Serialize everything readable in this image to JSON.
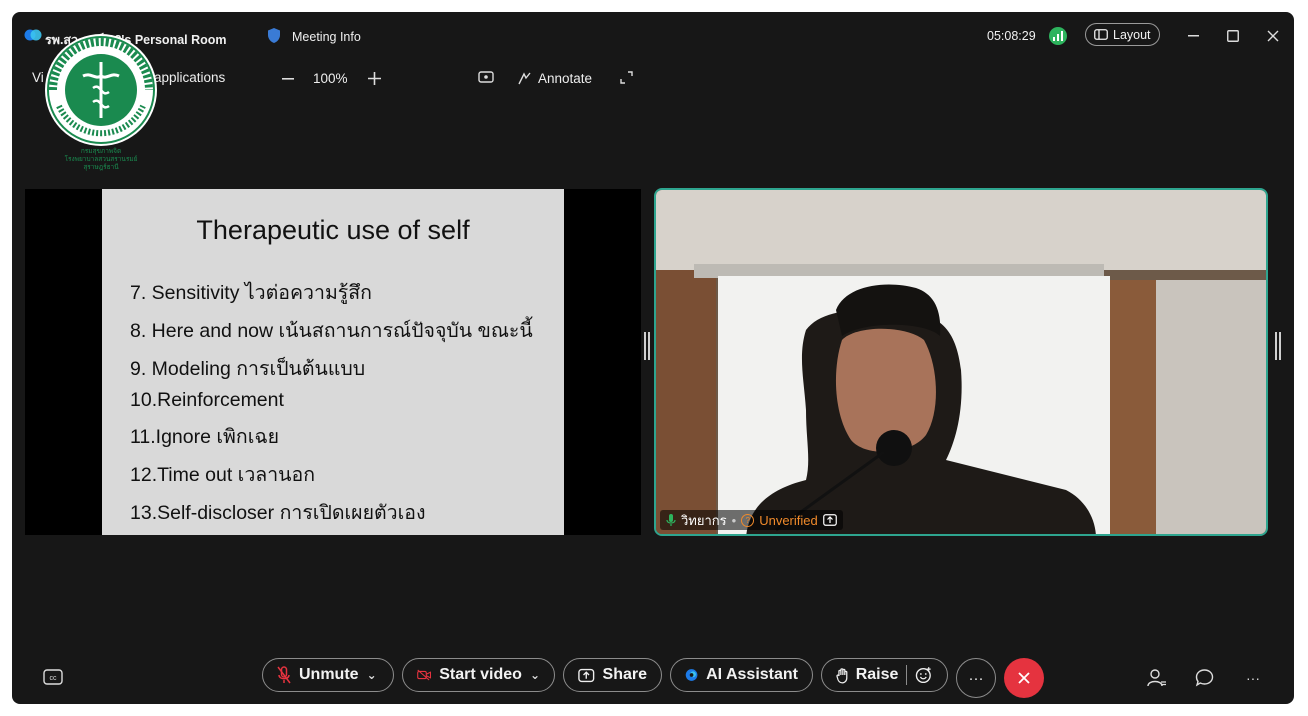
{
  "titlebar": {
    "room_title": "รพ.สว...มย์ 02's Personal Room",
    "meeting_info": "Meeting Info",
    "timer": "05:08:29",
    "layout_label": "Layout"
  },
  "share_toolbar": {
    "view_label": "Vi",
    "applications_label": "applications",
    "zoom_level": "100%",
    "annotate_label": "Annotate"
  },
  "logo": {
    "ring_text": "กระทรวงสาธารณสุข MINISTRY OF PUBLIC HEALTH",
    "caption_lines": [
      "กรมสุขภาพจิต",
      "โรงพยาบาลสวนสรานรมย์",
      "สุราษฎร์ธานี"
    ]
  },
  "slide": {
    "title": "Therapeutic use of self",
    "lines": [
      "7. Sensitivity  ไวต่อความรู้สึก",
      "8.  Here and now เน้นสถานการณ์ปัจจุบัน ขณะนี้",
      "9.  Modeling  การเป็นต้นแบบ",
      "10.Reinforcement",
      "11.Ignore  เพิกเฉย",
      "12.Time out  เวลานอก",
      "13.Self-discloser  การเปิดเผยตัวเอง"
    ]
  },
  "participant": {
    "name": "วิทยากร",
    "status": "Unverified"
  },
  "controls": {
    "unmute": "Unmute",
    "start_video": "Start video",
    "share": "Share",
    "ai_assistant": "AI Assistant",
    "raise": "Raise"
  },
  "colors": {
    "accent_teal": "#2ea58f",
    "end_call_red": "#e5333f",
    "unverified_orange": "#f08a2b",
    "signal_green": "#2db35d"
  }
}
